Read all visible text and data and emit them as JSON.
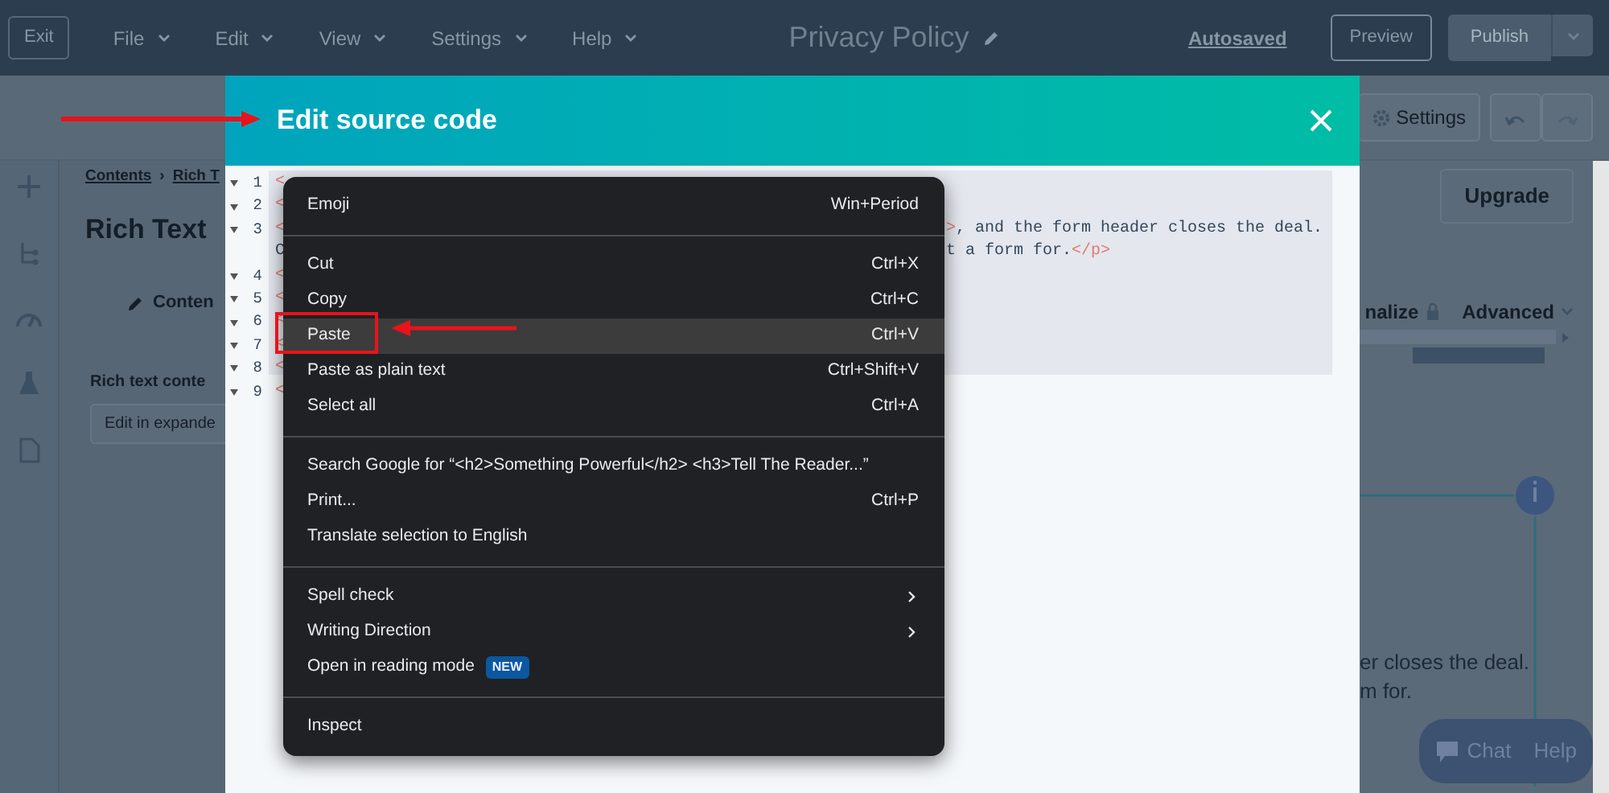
{
  "topbar": {
    "exit_button": "Exit",
    "menus": [
      "File",
      "Edit",
      "View",
      "Settings",
      "Help"
    ],
    "page_title": "Privacy Policy",
    "autosaved": "Autosaved",
    "preview_button": "Preview",
    "publish_button": {
      "label": "Publish",
      "disabled": true
    }
  },
  "toolbar": {
    "settings_button": "Settings"
  },
  "sidebar": {
    "breadcrumb": [
      "Contents",
      "Rich T"
    ],
    "breadcrumb_separator": "›",
    "heading": "Rich Text",
    "tab": "Conten",
    "field_label": "Rich text conte",
    "field_button": "Edit in expande"
  },
  "right_panel": {
    "upgrade_button": "Upgrade",
    "tabs": [
      "nalize",
      "Advanced"
    ],
    "preview_text": [
      "er closes the deal.",
      "m for."
    ],
    "chat": "Chat",
    "help": "Help"
  },
  "modal": {
    "title": "Edit source code",
    "lines": [
      {
        "number": "1",
        "left": [
          {
            "kind": "tag",
            "text": "<"
          }
        ]
      },
      {
        "number": "2",
        "left": [
          {
            "kind": "tag",
            "text": "<"
          }
        ]
      },
      {
        "number": "3",
        "left": [
          {
            "kind": "tag",
            "text": "<"
          }
        ],
        "right": [
          {
            "kind": "tag",
            "text": ">"
          },
          {
            "kind": "text",
            "text": ", and the form header closes the deal."
          }
        ]
      },
      {
        "left": [
          {
            "kind": "text",
            "text": "C"
          }
        ],
        "right": [
          {
            "kind": "text",
            "text": "t a form for."
          },
          {
            "kind": "tag",
            "text": "</p>"
          }
        ]
      },
      {
        "number": "4",
        "left": [
          {
            "kind": "tag",
            "text": "<"
          }
        ]
      },
      {
        "number": "5",
        "left": [
          {
            "kind": "tag",
            "text": "<"
          }
        ]
      },
      {
        "number": "6",
        "left": [
          {
            "kind": "tag",
            "text": "<"
          }
        ]
      },
      {
        "number": "7",
        "left": [
          {
            "kind": "tag",
            "text": "<"
          }
        ]
      },
      {
        "number": "8",
        "left": [
          {
            "kind": "tag",
            "text": "<"
          }
        ]
      },
      {
        "number": "9",
        "left": [
          {
            "kind": "tag",
            "text": "<"
          }
        ]
      }
    ]
  },
  "context_menu": [
    {
      "kind": "item",
      "label": "Emoji",
      "shortcut": "Win+Period",
      "selected": false
    },
    {
      "kind": "separator"
    },
    {
      "kind": "item",
      "label": "Cut",
      "shortcut": "Ctrl+X",
      "selected": false
    },
    {
      "kind": "item",
      "label": "Copy",
      "shortcut": "Ctrl+C",
      "selected": false
    },
    {
      "kind": "item",
      "label": "Paste",
      "shortcut": "Ctrl+V",
      "selected": true
    },
    {
      "kind": "item",
      "label": "Paste as plain text",
      "shortcut": "Ctrl+Shift+V",
      "selected": false
    },
    {
      "kind": "item",
      "label": "Select all",
      "shortcut": "Ctrl+A",
      "selected": false
    },
    {
      "kind": "separator"
    },
    {
      "kind": "item",
      "label": "Search Google for “<h2>Something Powerful</h2>  <h3>Tell The Reader...”",
      "selected": false
    },
    {
      "kind": "item",
      "label": "Print...",
      "shortcut": "Ctrl+P",
      "selected": false
    },
    {
      "kind": "item",
      "label": "Translate selection to English",
      "selected": false
    },
    {
      "kind": "separator"
    },
    {
      "kind": "submenu",
      "label": "Spell check",
      "selected": false
    },
    {
      "kind": "submenu",
      "label": "Writing Direction",
      "selected": false
    },
    {
      "kind": "item",
      "label": "Open in reading mode",
      "badge": "NEW",
      "selected": false
    },
    {
      "kind": "separator"
    },
    {
      "kind": "item",
      "label": "Inspect",
      "selected": false
    }
  ]
}
